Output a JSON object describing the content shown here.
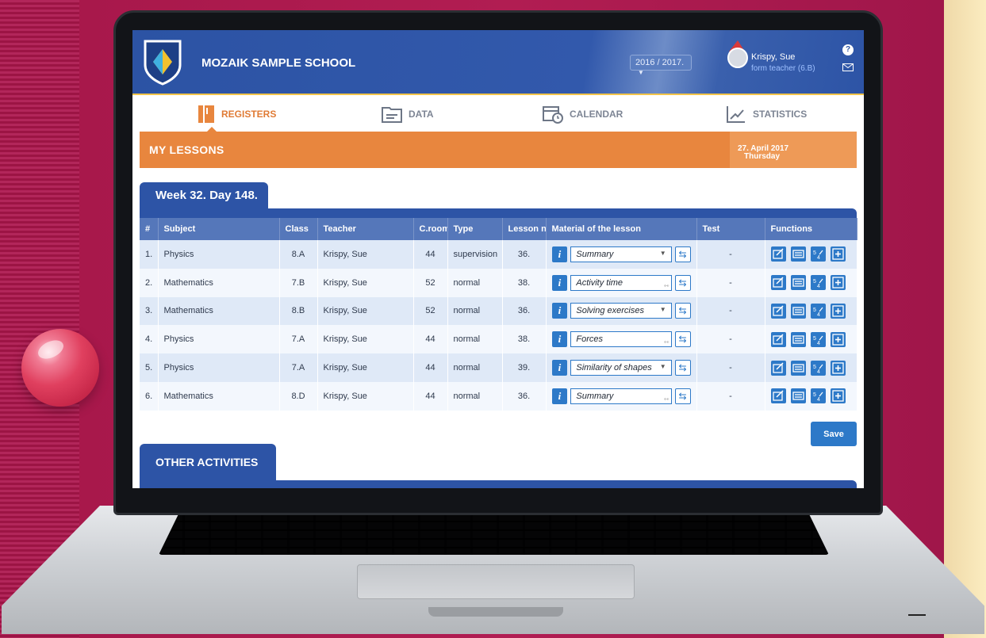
{
  "header": {
    "school_name": "MOZAIK SAMPLE SCHOOL",
    "school_year": "2016 / 2017.",
    "user_name": "Krispy, Sue",
    "user_role": "form teacher (6.B)",
    "help": "?"
  },
  "nav": {
    "items": [
      {
        "label": "REGISTERS",
        "icon": "book-icon"
      },
      {
        "label": "DATA",
        "icon": "folder-icon"
      },
      {
        "label": "CALENDAR",
        "icon": "calendar-icon"
      },
      {
        "label": "STATISTICS",
        "icon": "chart-icon"
      }
    ],
    "active": "REGISTERS"
  },
  "lessons_bar": {
    "title": "MY LESSONS",
    "date": "27. April 2017",
    "day": "Thursday"
  },
  "week_tab": "Week 32. Day 148.",
  "table": {
    "columns": [
      "#",
      "Subject",
      "Class",
      "Teacher",
      "C.room",
      "Type",
      "Lesson nr.",
      "Material of the lesson",
      "Test",
      "Functions"
    ],
    "rows": [
      {
        "num": "1.",
        "subject": "Physics",
        "class": "8.A",
        "teacher": "Krispy, Sue",
        "room": "44",
        "type": "supervision",
        "lesson": "36.",
        "material": "Summary",
        "control": "dropdown",
        "test": "-"
      },
      {
        "num": "2.",
        "subject": "Mathematics",
        "class": "7.B",
        "teacher": "Krispy, Sue",
        "room": "52",
        "type": "normal",
        "lesson": "38.",
        "material": "Activity time",
        "control": "textarea",
        "test": "-"
      },
      {
        "num": "3.",
        "subject": "Mathematics",
        "class": "8.B",
        "teacher": "Krispy, Sue",
        "room": "52",
        "type": "normal",
        "lesson": "36.",
        "material": "Solving exercises",
        "control": "dropdown",
        "test": "-"
      },
      {
        "num": "4.",
        "subject": "Physics",
        "class": "7.A",
        "teacher": "Krispy, Sue",
        "room": "44",
        "type": "normal",
        "lesson": "38.",
        "material": "Forces",
        "control": "textarea",
        "test": "-"
      },
      {
        "num": "5.",
        "subject": "Physics",
        "class": "7.A",
        "teacher": "Krispy, Sue",
        "room": "44",
        "type": "normal",
        "lesson": "39.",
        "material": "Similarity of shapes",
        "control": "dropdown",
        "test": "-"
      },
      {
        "num": "6.",
        "subject": "Mathematics",
        "class": "8.D",
        "teacher": "Krispy, Sue",
        "room": "44",
        "type": "normal",
        "lesson": "36.",
        "material": "Summary",
        "control": "textarea",
        "test": "-"
      }
    ],
    "info_label": "i",
    "function_icons": [
      "edit-icon",
      "absence-icon",
      "grade-icon",
      "add-icon"
    ]
  },
  "save_label": "Save",
  "other_tab": "OTHER ACTIVITIES",
  "colors": {
    "primary_blue": "#2d54a6",
    "accent_orange": "#e8863e",
    "button_blue": "#2d79c8",
    "background": "#a3184a"
  }
}
